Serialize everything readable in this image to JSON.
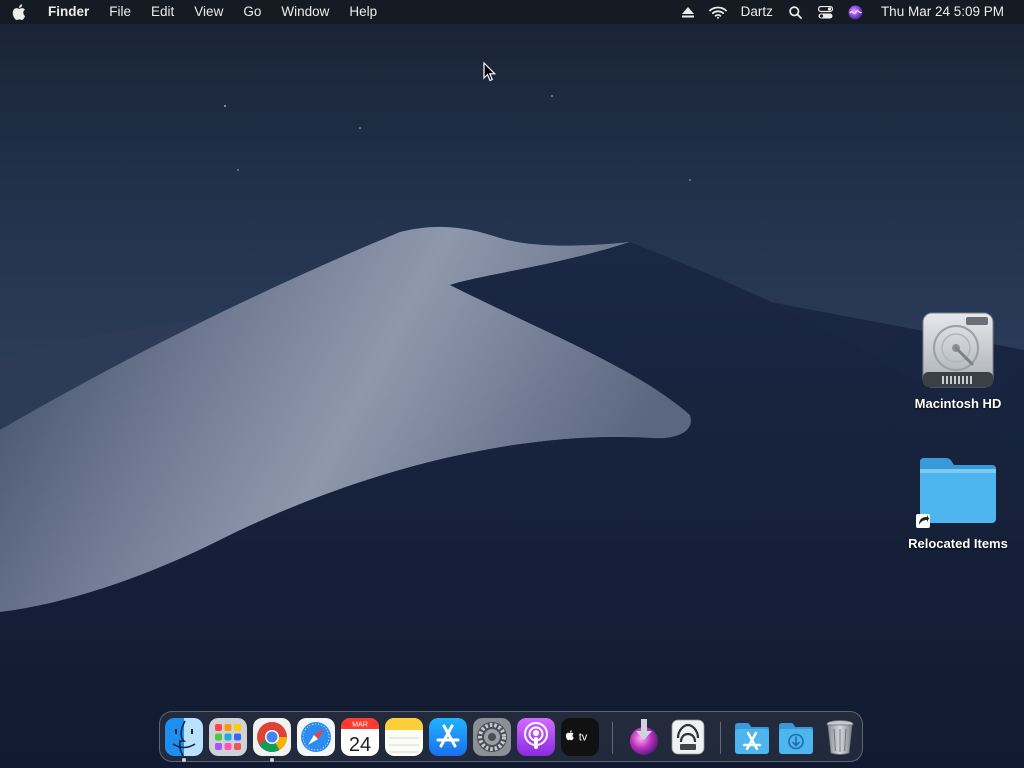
{
  "menubar": {
    "apple_icon": "apple-logo-icon",
    "app_name": "Finder",
    "menus": [
      "File",
      "Edit",
      "View",
      "Go",
      "Window",
      "Help"
    ],
    "status": {
      "eject_icon": "eject-icon",
      "wifi_icon": "wifi-icon",
      "user_name": "Dartz",
      "search_icon": "spotlight-search-icon",
      "control_center_icon": "control-center-icon",
      "siri_icon": "siri-icon",
      "clock": "Thu Mar 24  5:09 PM"
    }
  },
  "desktop": {
    "icons": [
      {
        "label": "Macintosh HD",
        "icon": "hard-drive-icon"
      },
      {
        "label": "Relocated Items",
        "icon": "folder-alias-icon"
      }
    ]
  },
  "dock": {
    "apps": [
      {
        "name": "finder",
        "icon": "finder-icon",
        "running": true
      },
      {
        "name": "launchpad",
        "icon": "launchpad-icon",
        "running": false
      },
      {
        "name": "chrome",
        "icon": "chrome-icon",
        "running": true
      },
      {
        "name": "safari",
        "icon": "safari-icon",
        "running": false
      },
      {
        "name": "calendar",
        "icon": "calendar-icon",
        "running": false,
        "month": "MAR",
        "day": "24"
      },
      {
        "name": "notes",
        "icon": "notes-icon",
        "running": false
      },
      {
        "name": "app-store",
        "icon": "app-store-icon",
        "running": false
      },
      {
        "name": "system-preferences",
        "icon": "gear-icon",
        "running": false
      },
      {
        "name": "podcasts",
        "icon": "podcasts-icon",
        "running": false
      },
      {
        "name": "apple-tv",
        "icon": "apple-tv-icon",
        "running": false,
        "text": "tv"
      },
      {
        "name": "disk-utility-installer",
        "icon": "installer-icon",
        "running": false
      },
      {
        "name": "migration-assistant",
        "icon": "migration-assistant-icon",
        "running": false
      },
      {
        "name": "applications-folder",
        "icon": "applications-folder-icon",
        "running": false
      },
      {
        "name": "downloads-folder",
        "icon": "downloads-folder-icon",
        "running": false
      },
      {
        "name": "trash",
        "icon": "trash-icon",
        "running": false
      }
    ]
  },
  "colors": {
    "menubar_bg": "#16181e",
    "folder_blue": "#45b4ee",
    "dune_light": "#8a94a8",
    "sky_dark": "#182235"
  }
}
